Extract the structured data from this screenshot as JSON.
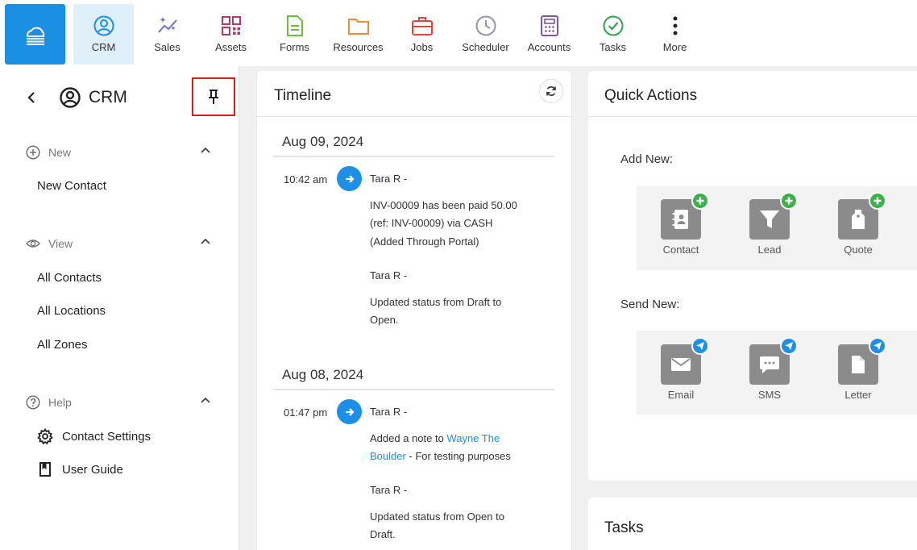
{
  "nav": {
    "items": [
      {
        "label": "CRM",
        "icon": "crm-icon"
      },
      {
        "label": "Sales",
        "icon": "sales-icon"
      },
      {
        "label": "Assets",
        "icon": "assets-icon"
      },
      {
        "label": "Forms",
        "icon": "forms-icon"
      },
      {
        "label": "Resources",
        "icon": "resources-icon"
      },
      {
        "label": "Jobs",
        "icon": "jobs-icon"
      },
      {
        "label": "Scheduler",
        "icon": "scheduler-icon"
      },
      {
        "label": "Accounts",
        "icon": "accounts-icon"
      },
      {
        "label": "Tasks",
        "icon": "tasks-icon"
      },
      {
        "label": "More",
        "icon": "more-icon"
      }
    ]
  },
  "sidebar": {
    "title": "CRM",
    "sections": [
      {
        "label": "New",
        "items": [
          "New Contact"
        ]
      },
      {
        "label": "View",
        "items": [
          "All Contacts",
          "All Locations",
          "All Zones"
        ]
      },
      {
        "label": "Help",
        "items": [
          "Contact Settings",
          "User Guide"
        ]
      }
    ]
  },
  "timeline": {
    "title": "Timeline",
    "days": [
      {
        "date": "Aug 09, 2024",
        "time": "10:42 am",
        "entries": [
          {
            "author": "Tara R -",
            "lines": [
              "INV-00009 has been paid 50.00",
              "(ref: INV-00009) via CASH",
              "(Added Through Portal)"
            ]
          },
          {
            "author": "Tara R -",
            "lines": [
              "Updated status from Draft to",
              "Open."
            ]
          }
        ]
      },
      {
        "date": "Aug 08, 2024",
        "time": "01:47 pm",
        "entries": [
          {
            "author": "Tara R -",
            "pre": "Added a note to ",
            "link1": "Wayne The",
            "link2": "Boulder",
            "post": " - For testing purposes"
          },
          {
            "author": "Tara R -",
            "lines": [
              "Updated status from Open to",
              "Draft."
            ]
          }
        ]
      }
    ]
  },
  "quick_actions": {
    "title": "Quick Actions",
    "add_label": "Add New:",
    "add_items": [
      {
        "label": "Contact",
        "icon": "contact-book-icon"
      },
      {
        "label": "Lead",
        "icon": "funnel-icon"
      },
      {
        "label": "Quote",
        "icon": "price-tag-icon"
      }
    ],
    "send_label": "Send New:",
    "send_items": [
      {
        "label": "Email",
        "icon": "envelope-icon"
      },
      {
        "label": "SMS",
        "icon": "chat-bubble-icon"
      },
      {
        "label": "Letter",
        "icon": "document-icon"
      }
    ]
  },
  "tasks": {
    "title": "Tasks"
  },
  "colors": {
    "brand": "#1a8fe3",
    "accent": "#1e8fe8",
    "add_badge": "#3cb14a",
    "pin_highlight": "#e0191c"
  }
}
